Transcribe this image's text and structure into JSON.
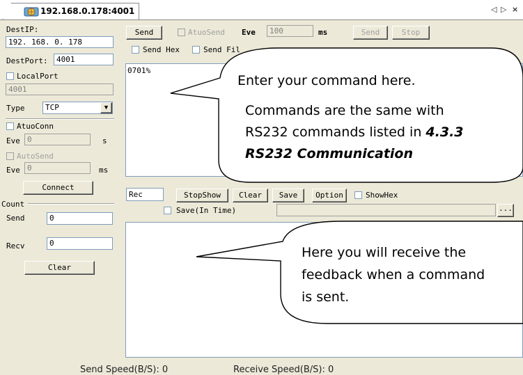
{
  "tab": {
    "title": "192.168.0.178:4001",
    "controls": [
      "◁",
      "▷",
      "×"
    ]
  },
  "left": {
    "dest_ip_label": "DestIP:",
    "dest_ip_value": "192. 168. 0. 178",
    "dest_port_label": "DestPort:",
    "dest_port_value": "4001",
    "local_port_label": "LocalPort",
    "local_port_value": "4001",
    "type_label": "Type",
    "type_value": "TCP",
    "auto_conn_label": "AtuoConn",
    "eve1_label": "Eve",
    "eve1_value": "0",
    "eve1_unit": "s",
    "auto_send_label": "AutoSend",
    "eve2_label": "Eve",
    "eve2_value": "0",
    "eve2_unit": "ms",
    "connect_label": "Connect",
    "count_label": "Count",
    "send_label": "Send",
    "send_value": "0",
    "recv_label": "Recv",
    "recv_value": "0",
    "clear_label": "Clear"
  },
  "send_section": {
    "send_label": "Send",
    "auto_send_label": "AtuoSend",
    "eve_label": "Eve",
    "eve_value": "100",
    "ms_label": "ms",
    "send_btn": "Send",
    "stop_btn": "Stop",
    "send_hex_label": "Send Hex",
    "send_file_label": "Send Fil",
    "text": "0701%"
  },
  "rec_section": {
    "rec_label": "Rec",
    "stop_show_btn": "StopShow",
    "clear_btn": "Clear",
    "save_btn": "Save",
    "option_btn": "Option",
    "show_hex_label": "ShowHex",
    "save_in_time_label": "Save(In Time)",
    "browse_btn": "..."
  },
  "callouts": {
    "send_lines": [
      "Enter your command here.",
      "Commands are the same with",
      "RS232 commands listed in "
    ],
    "send_ref_a": "4.3.3",
    "send_ref_b": "RS232 Communication",
    "recv_lines": [
      "Here you will receive the",
      "feedback when a command",
      "is sent."
    ]
  },
  "status": {
    "send_speed": "Send Speed(B/S): 0",
    "receive_speed": "Receive Speed(B/S): 0"
  }
}
